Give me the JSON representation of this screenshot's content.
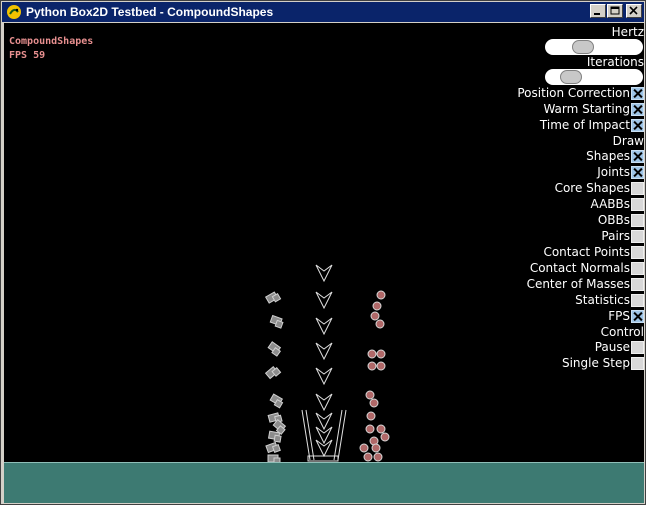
{
  "window": {
    "title": "Python Box2D Testbed - CompoundShapes",
    "icon": "pygame-snake-icon",
    "buttons": {
      "minimize": "_",
      "maximize": "□",
      "close": "✕"
    }
  },
  "hud": {
    "test_name": "CompoundShapes",
    "fps_text": "FPS 59"
  },
  "panel": {
    "hertz_label": "Hertz",
    "hertz_level": 0.35,
    "iterations_label": "Iterations",
    "iterations_level": 0.18,
    "position_correction": {
      "label": "Position Correction",
      "checked": true
    },
    "warm_starting": {
      "label": "Warm Starting",
      "checked": true
    },
    "time_of_impact": {
      "label": "Time of Impact",
      "checked": true
    },
    "draw_label": "Draw",
    "shapes": {
      "label": "Shapes",
      "checked": true
    },
    "joints": {
      "label": "Joints",
      "checked": true
    },
    "core_shapes": {
      "label": "Core Shapes",
      "checked": false
    },
    "aabbs": {
      "label": "AABBs",
      "checked": false
    },
    "obbs": {
      "label": "OBBs",
      "checked": false
    },
    "pairs": {
      "label": "Pairs",
      "checked": false
    },
    "contact_points": {
      "label": "Contact Points",
      "checked": false
    },
    "contact_normals": {
      "label": "Contact Normals",
      "checked": false
    },
    "center_of_masses": {
      "label": "Center of Masses",
      "checked": false
    },
    "statistics": {
      "label": "Statistics",
      "checked": false
    },
    "fps": {
      "label": "FPS",
      "checked": true
    },
    "control_label": "Control",
    "pause": {
      "label": "Pause",
      "checked": false
    },
    "single_step": {
      "label": "Single Step",
      "checked": false
    }
  },
  "colors": {
    "background": "#000000",
    "ground": "#3d7a72",
    "hud_text": "#e89090",
    "shape_fill": "#8c8c8c",
    "circle_fill": "#b06868",
    "checkbox_on": "#9ec4e6"
  }
}
